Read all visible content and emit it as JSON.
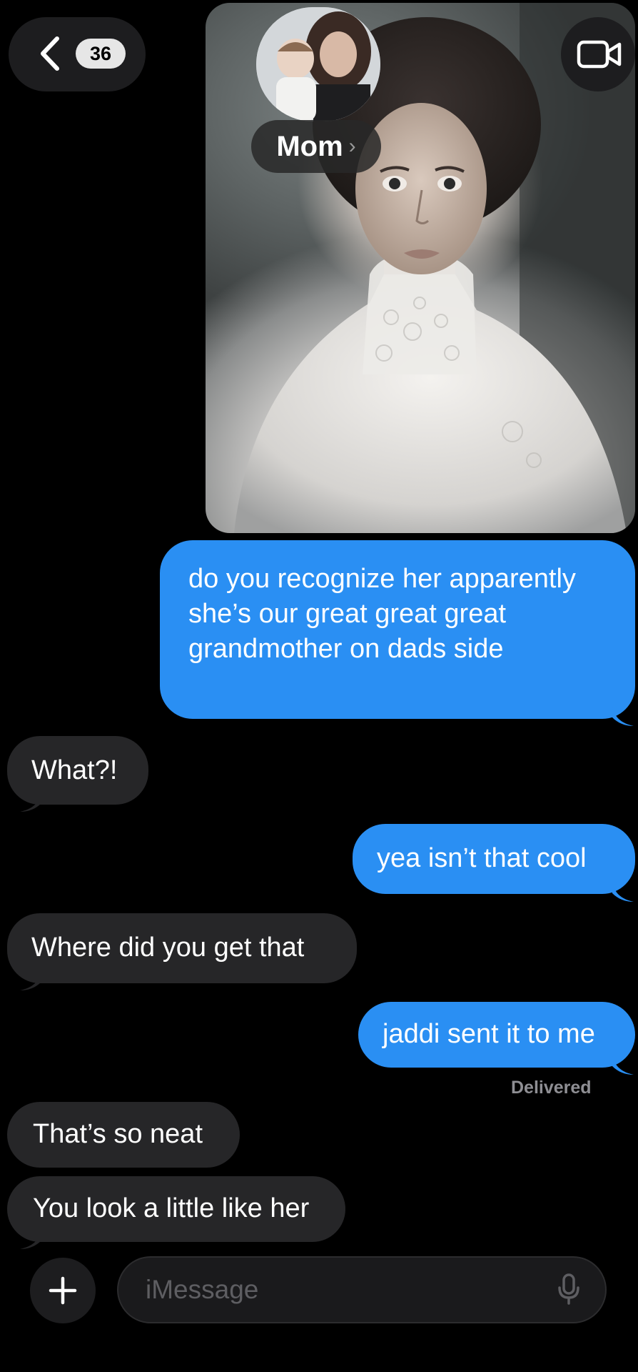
{
  "header": {
    "unread_count": "36",
    "contact_name": "Mom",
    "name_chevron": "›"
  },
  "messages": [
    {
      "direction": "sent",
      "text": "do you recognize her apparently she’s our great great great grandmother on dads side"
    },
    {
      "direction": "received",
      "text": "What?!"
    },
    {
      "direction": "sent",
      "text": "yea isn’t that cool"
    },
    {
      "direction": "received",
      "text": "Where did you get that"
    },
    {
      "direction": "sent",
      "text": "jaddi sent it to me"
    },
    {
      "direction": "received",
      "text": "That’s so neat"
    },
    {
      "direction": "received",
      "text": "You look a little like her"
    }
  ],
  "status": {
    "delivered_label": "Delivered"
  },
  "composer": {
    "placeholder": "iMessage"
  },
  "colors": {
    "sent_bubble": "#2a8ff3",
    "received_bubble": "#262628",
    "background": "#000000"
  },
  "icons": {
    "back": "chevron-left-icon",
    "video": "video-camera-icon",
    "plus": "plus-icon",
    "mic": "microphone-icon"
  }
}
